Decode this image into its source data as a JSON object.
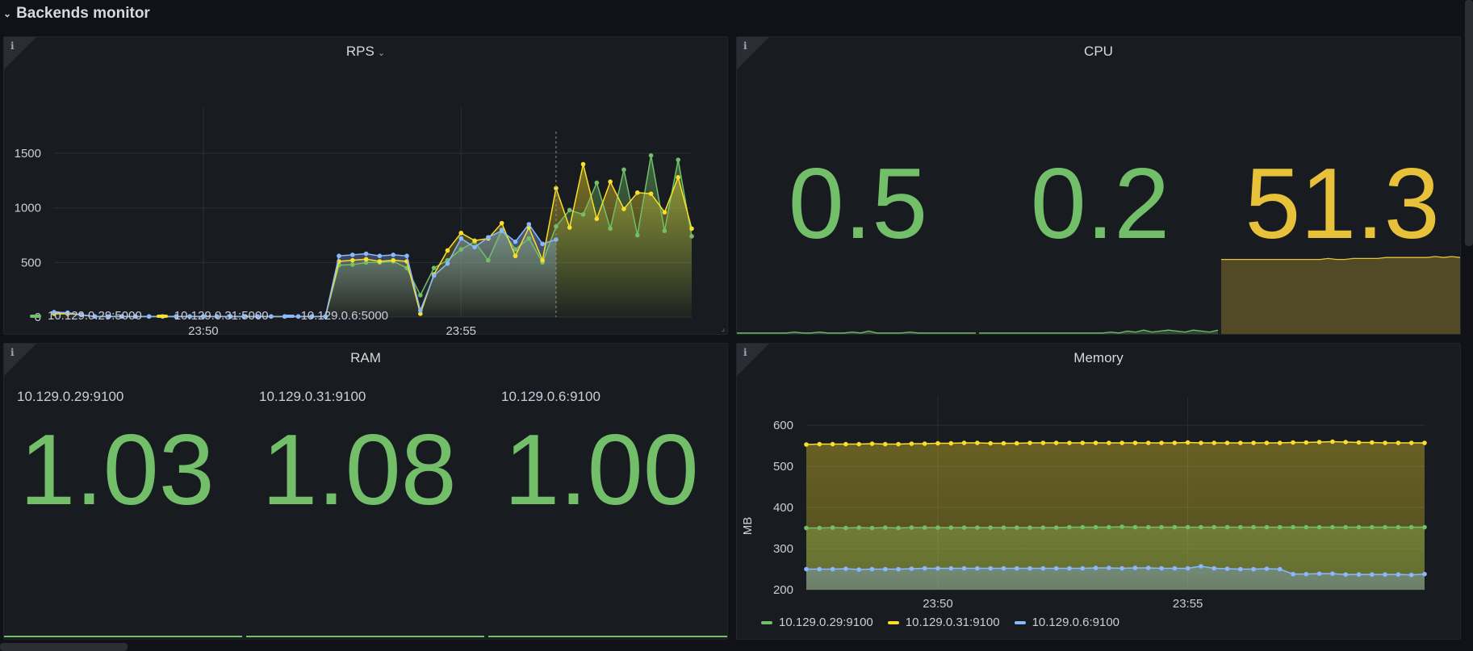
{
  "row": {
    "title": "Backends monitor"
  },
  "colors": {
    "green": "#73bf69",
    "yellow": "#fade2a",
    "blue": "#8ab8ff",
    "stat_green": "#73bf69",
    "stat_yellow": "#e8c13a"
  },
  "panels": {
    "rps": {
      "title": "RPS",
      "legend": [
        "10.129.0.29:5000",
        "10.129.0.31:5000",
        "10.129.0.6:5000"
      ]
    },
    "cpu": {
      "title": "CPU",
      "values": [
        "0.5",
        "0.2",
        "51.3"
      ]
    },
    "ram": {
      "title": "RAM",
      "stats": [
        {
          "label": "10.129.0.29:9100",
          "value": "1.03"
        },
        {
          "label": "10.129.0.31:9100",
          "value": "1.08"
        },
        {
          "label": "10.129.0.6:9100",
          "value": "1.00"
        }
      ]
    },
    "memory": {
      "title": "Memory",
      "legend": [
        "10.129.0.29:9100",
        "10.129.0.31:9100",
        "10.129.0.6:9100"
      ]
    }
  },
  "chart_data": [
    {
      "type": "line",
      "panel": "RPS",
      "title": "RPS",
      "xlabel": "",
      "ylabel": "",
      "x_ticks": [
        "23:50",
        "23:55"
      ],
      "y_ticks": [
        0,
        500,
        1000,
        1500
      ],
      "ylim": [
        0,
        1700
      ],
      "grid": true,
      "legend": "bottom-left",
      "series": [
        {
          "name": "10.129.0.29:5000",
          "color": "#73bf69",
          "values": [
            40,
            35,
            20,
            5,
            5,
            5,
            5,
            5,
            5,
            5,
            5,
            5,
            5,
            5,
            5,
            5,
            5,
            5,
            5,
            5,
            5,
            475,
            480,
            500,
            500,
            510,
            450,
            200,
            450,
            520,
            620,
            690,
            520,
            800,
            620,
            720,
            500,
            830,
            980,
            940,
            1230,
            810,
            1350,
            750,
            1480,
            790,
            1440,
            740
          ]
        },
        {
          "name": "10.129.0.31:5000",
          "color": "#fade2a",
          "values": [
            30,
            30,
            20,
            5,
            5,
            5,
            5,
            5,
            5,
            5,
            5,
            5,
            5,
            5,
            5,
            5,
            5,
            5,
            5,
            5,
            5,
            510,
            520,
            530,
            510,
            520,
            510,
            30,
            390,
            610,
            770,
            700,
            720,
            860,
            560,
            820,
            520,
            1180,
            820,
            1400,
            900,
            1240,
            990,
            1140,
            1130,
            960,
            1280,
            810
          ]
        },
        {
          "name": "10.129.0.6:5000",
          "color": "#8ab8ff",
          "values": [
            45,
            40,
            20,
            5,
            5,
            5,
            5,
            5,
            5,
            5,
            5,
            5,
            5,
            5,
            5,
            5,
            5,
            5,
            5,
            5,
            5,
            560,
            570,
            580,
            560,
            570,
            560,
            60,
            380,
            490,
            720,
            640,
            730,
            790,
            690,
            850,
            670,
            710
          ]
        }
      ]
    },
    {
      "type": "area",
      "panel": "Memory",
      "title": "Memory",
      "xlabel": "",
      "ylabel": "MB",
      "x_ticks": [
        "23:50",
        "23:55"
      ],
      "y_ticks": [
        200,
        300,
        400,
        500,
        600
      ],
      "ylim": [
        200,
        610
      ],
      "grid": true,
      "legend": "bottom-left",
      "series": [
        {
          "name": "10.129.0.29:9100",
          "color": "#73bf69",
          "values": [
            350,
            350,
            351,
            350,
            351,
            350,
            351,
            350,
            351,
            351,
            351,
            351,
            351,
            351,
            351,
            351,
            351,
            351,
            351,
            351,
            352,
            352,
            352,
            352,
            353,
            352,
            352,
            352,
            352,
            352,
            352,
            352,
            352,
            352,
            352,
            352,
            352,
            352,
            352,
            352,
            352,
            352,
            352,
            352,
            352,
            352,
            352,
            352
          ]
        },
        {
          "name": "10.129.0.31:9100",
          "color": "#fade2a",
          "values": [
            553,
            554,
            554,
            554,
            554,
            555,
            554,
            554,
            555,
            555,
            556,
            556,
            557,
            557,
            556,
            556,
            556,
            557,
            557,
            557,
            557,
            557,
            557,
            557,
            557,
            557,
            557,
            557,
            557,
            558,
            557,
            557,
            557,
            557,
            557,
            557,
            557,
            558,
            558,
            559,
            560,
            559,
            558,
            558,
            557,
            557,
            557,
            557
          ]
        },
        {
          "name": "10.129.0.6:9100",
          "color": "#8ab8ff",
          "values": [
            250,
            250,
            250,
            251,
            249,
            250,
            250,
            250,
            251,
            252,
            252,
            252,
            252,
            252,
            252,
            252,
            252,
            252,
            252,
            252,
            252,
            252,
            253,
            253,
            252,
            253,
            253,
            252,
            252,
            252,
            257,
            252,
            251,
            250,
            250,
            251,
            250,
            238,
            238,
            239,
            239,
            237,
            237,
            237,
            237,
            237,
            236,
            238
          ]
        }
      ]
    },
    {
      "type": "area",
      "panel": "CPU sparklines",
      "title": "",
      "series": [
        {
          "color": "#73bf69",
          "values": [
            1,
            1,
            1,
            1,
            1,
            1,
            1,
            2,
            1,
            1,
            2,
            1,
            1,
            1,
            2,
            1,
            3,
            1,
            1,
            1,
            1,
            2,
            1,
            1,
            1,
            1,
            1,
            1,
            1,
            1
          ]
        },
        {
          "color": "#73bf69",
          "values": [
            1,
            1,
            1,
            1,
            1,
            1,
            1,
            1,
            1,
            1,
            1,
            1,
            1,
            1,
            1,
            1,
            2,
            1,
            3,
            2,
            4,
            2,
            3,
            4,
            3,
            2,
            4,
            3,
            2,
            4
          ]
        },
        {
          "color": "#e8c13a",
          "values": [
            77,
            77,
            77,
            77,
            77,
            77,
            77,
            77,
            77,
            77,
            77,
            77,
            77,
            78,
            77,
            77,
            78,
            78,
            78,
            78,
            79,
            79,
            79,
            79,
            79,
            79,
            80,
            79,
            80,
            79
          ]
        }
      ]
    }
  ]
}
